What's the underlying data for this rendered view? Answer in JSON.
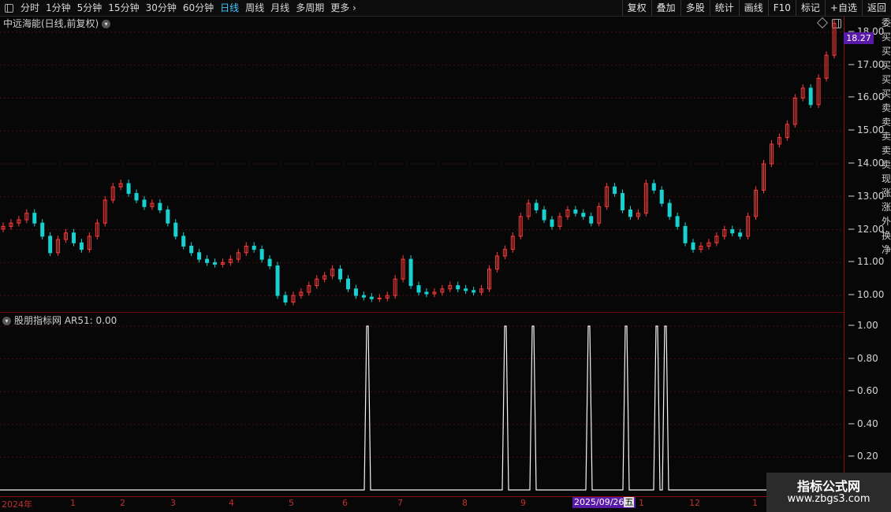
{
  "toolbar": {
    "periods": [
      "分时",
      "1分钟",
      "5分钟",
      "15分钟",
      "30分钟",
      "60分钟",
      "日线",
      "周线",
      "月线",
      "多周期",
      "更多"
    ],
    "active_period": "日线",
    "buttons": [
      "复权",
      "叠加",
      "多股",
      "统计",
      "画线",
      "F10",
      "标记",
      "+自选",
      "返回"
    ]
  },
  "main_chart": {
    "title": "中远海能(日线,前复权)",
    "y_ticks": [
      "18.00",
      "17.00",
      "16.00",
      "15.00",
      "14.00",
      "13.00",
      "12.00",
      "11.00",
      "10.00"
    ],
    "last_price": "18.27"
  },
  "sub_chart": {
    "title": "股朋指标网 AR51: 0.00",
    "y_ticks": [
      "1.00",
      "0.80",
      "0.60",
      "0.40",
      "0.20"
    ]
  },
  "x_axis": {
    "labels": [
      "2024年",
      "1",
      "2",
      "3",
      "4",
      "5",
      "6",
      "7",
      "8",
      "9",
      "1",
      "12",
      "1"
    ],
    "cursor_date": "2025/09/26",
    "cursor_weekday": "五"
  },
  "right_strip": [
    "委",
    "买",
    "买",
    "买",
    "买",
    "买",
    "卖",
    "卖",
    "卖",
    "卖",
    "卖",
    "现",
    "涨",
    "涨",
    "外",
    "换",
    "净"
  ],
  "watermark": {
    "line1": "指标公式网",
    "line2": "www.zbgs3.com"
  },
  "colors": {
    "up": "#ff3b3b",
    "down": "#18d0d0",
    "accent": "#3fc9ff",
    "tag": "#5a1aa8"
  },
  "chart_data": [
    {
      "type": "candlestick",
      "series": [
        {
          "values": [
            12.1,
            12.2,
            12.3,
            12.5,
            12.2,
            11.8,
            11.3,
            11.7,
            11.9,
            11.6,
            11.4,
            11.8,
            12.2,
            12.9,
            13.3,
            13.4,
            13.1,
            12.9,
            12.7,
            12.8,
            12.6,
            12.2,
            11.8,
            11.5,
            11.3,
            11.1,
            11.0,
            10.95,
            11.0,
            11.1,
            11.3,
            11.5,
            11.4,
            11.1,
            10.9,
            10.0,
            9.8,
            10.0,
            10.1,
            10.3,
            10.5,
            10.6,
            10.8,
            10.5,
            10.2,
            10.0,
            9.95,
            9.9,
            9.92,
            10.0,
            10.5,
            11.1,
            10.3,
            10.1,
            10.05,
            10.1,
            10.2,
            10.3,
            10.2,
            10.15,
            10.1,
            10.2,
            10.8,
            11.2,
            11.4,
            11.8,
            12.4,
            12.8,
            12.6,
            12.3,
            12.1,
            12.4,
            12.6,
            12.5,
            12.4,
            12.2,
            12.7,
            13.3,
            13.1,
            12.6,
            12.4,
            12.5,
            13.4,
            13.2,
            12.8,
            12.4,
            12.1,
            11.6,
            11.4,
            11.5,
            11.6,
            11.8,
            12.0,
            11.9,
            11.8,
            12.4,
            13.2,
            14.0,
            14.6,
            14.8,
            15.2,
            16.0,
            16.3,
            15.8,
            16.6,
            17.3,
            18.27
          ]
        }
      ],
      "ylim": [
        9.5,
        18.5
      ]
    },
    {
      "type": "line",
      "series": [
        {
          "name": "AR51",
          "values": [
            0,
            0,
            0,
            0,
            0,
            1,
            0,
            0,
            0,
            0,
            1,
            0,
            1,
            0,
            0,
            1,
            0,
            1,
            0,
            1,
            1,
            0,
            0,
            0,
            0
          ]
        }
      ],
      "ylim": [
        0,
        1.0
      ]
    }
  ]
}
